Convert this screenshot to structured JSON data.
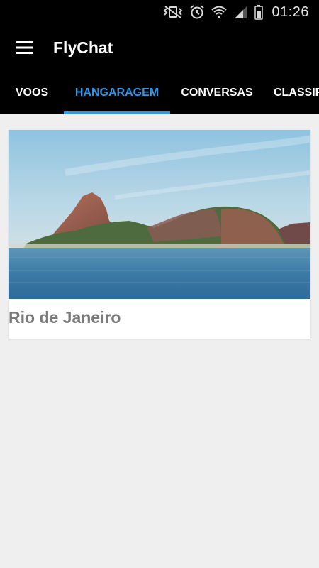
{
  "status_bar": {
    "time": "01:26",
    "icons": [
      "mute-vibrate-icon",
      "alarm-icon",
      "wifi-icon",
      "signal-icon",
      "battery-icon"
    ]
  },
  "app_bar": {
    "title": "FlyChat",
    "menu_icon": "hamburger-menu-icon"
  },
  "tabs": [
    {
      "label": "VOOS",
      "active": false
    },
    {
      "label": "HANGARAGEM",
      "active": true
    },
    {
      "label": "CONVERSAS",
      "active": false
    },
    {
      "label": "CLASSIFICADOS",
      "active": false
    }
  ],
  "cards": [
    {
      "title": "Rio de Janeiro",
      "image": "sugarloaf-mountain-photo"
    }
  ],
  "colors": {
    "accent": "#2f97e8",
    "app_bar": "#000000",
    "background": "#efefef",
    "card_title": "#7a7a7a"
  }
}
